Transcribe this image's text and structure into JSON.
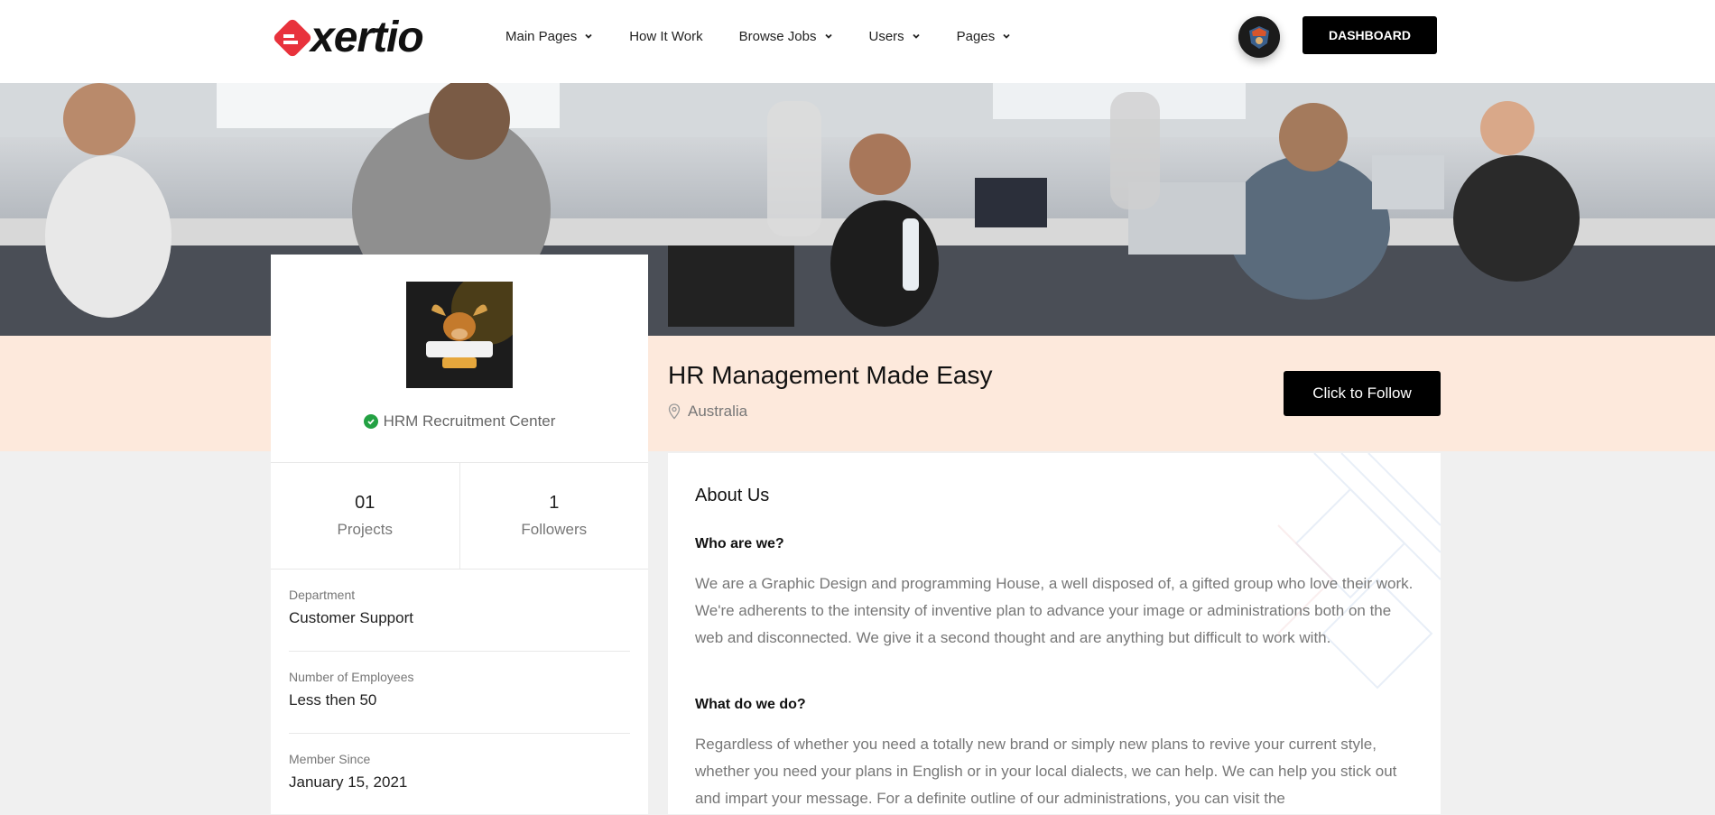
{
  "header": {
    "logo_text": "xertio",
    "nav": [
      {
        "label": "Main Pages",
        "dropdown": true
      },
      {
        "label": "How It Work",
        "dropdown": false
      },
      {
        "label": "Browse Jobs",
        "dropdown": true
      },
      {
        "label": "Users",
        "dropdown": true
      },
      {
        "label": "Pages",
        "dropdown": true
      }
    ],
    "dashboard_label": "DASHBOARD"
  },
  "profile": {
    "company_name": "HRM Recruitment Center",
    "stats": [
      {
        "value": "01",
        "label": "Projects"
      },
      {
        "value": "1",
        "label": "Followers"
      }
    ],
    "info": [
      {
        "label": "Department",
        "value": "Customer Support"
      },
      {
        "label": "Number of Employees",
        "value": "Less then 50"
      },
      {
        "label": "Member Since",
        "value": "January 15, 2021"
      }
    ]
  },
  "company": {
    "title": "HR Management Made Easy",
    "location": "Australia",
    "follow_label": "Click to Follow"
  },
  "about": {
    "heading": "About Us",
    "q1": "Who are we?",
    "p1": "We are a Graphic Design and programming House, a well disposed of, a gifted group who love their work. We're adherents to the intensity of inventive plan to advance your image or administrations both on the web and disconnected. We give it a second thought and are anything but difficult to work with.",
    "q2": "What do we do?",
    "p2": "Regardless of whether you need a totally new brand or simply new plans to revive your current style, whether you need your plans in English or in your local dialects, we can help. We can help you stick out and impart your message. For a definite outline of our administrations, you can visit the"
  },
  "colors": {
    "accent": "#e8323c",
    "peach": "#fde9dc",
    "verified": "#23a143"
  }
}
